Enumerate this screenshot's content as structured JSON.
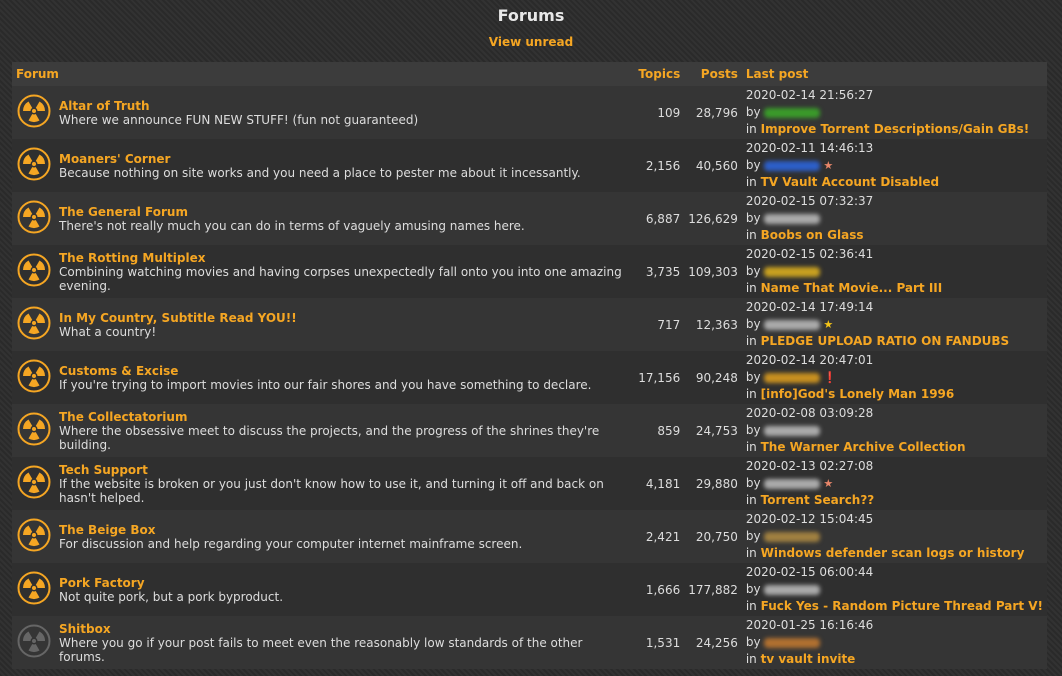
{
  "title": "Forums",
  "view_unread": "View unread",
  "headers": {
    "forum": "Forum",
    "topics": "Topics",
    "posts": "Posts",
    "last_post": "Last post"
  },
  "by": "by",
  "in": "in",
  "forums": [
    {
      "name": "Altar of Truth",
      "desc": "Where we announce FUN NEW STUFF! (fun not guaranteed)",
      "topics": "109",
      "posts": "28,796",
      "date": "2020-02-14 21:56:27",
      "user_color": "#3a9a2a",
      "badge": "",
      "thread": "Improve Torrent Descriptions/Gain GBs!",
      "icon_color": "#f5a623"
    },
    {
      "name": "Moaners' Corner",
      "desc": "Because nothing on site works and you need a place to pester me about it incessantly.",
      "topics": "2,156",
      "posts": "40,560",
      "date": "2020-02-11 14:46:13",
      "user_color": "#2d5fc8",
      "badge": "★",
      "badge_color": "#e8866a",
      "thread": "TV Vault Account Disabled",
      "icon_color": "#f5a623"
    },
    {
      "name": "The General Forum",
      "desc": "There's not really much you can do in terms of vaguely amusing names here.",
      "topics": "6,887",
      "posts": "126,629",
      "date": "2020-02-15 07:32:37",
      "user_color": "#aaaaaa",
      "badge": "",
      "thread": "Boobs on Glass",
      "icon_color": "#f5a623"
    },
    {
      "name": "The Rotting Multiplex",
      "desc": "Combining watching movies and having corpses unexpectedly fall onto you into one amazing evening.",
      "topics": "3,735",
      "posts": "109,303",
      "date": "2020-02-15 02:36:41",
      "user_color": "#c8a020",
      "badge": "",
      "thread": "Name That Movie... Part III",
      "icon_color": "#f5a623"
    },
    {
      "name": "In My Country, Subtitle Read YOU!!",
      "desc": "What a country!",
      "topics": "717",
      "posts": "12,363",
      "date": "2020-02-14 17:49:14",
      "user_color": "#aaaaaa",
      "badge": "★",
      "badge_color": "#f5c518",
      "thread": "PLEDGE UPLOAD RATIO ON FANDUBS",
      "icon_color": "#f5a623"
    },
    {
      "name": "Customs & Excise",
      "desc": "If you're trying to import movies into our fair shores and you have something to declare.",
      "topics": "17,156",
      "posts": "90,248",
      "date": "2020-02-14 20:47:01",
      "user_color": "#c89020",
      "badge": "❗",
      "badge_color": "#e02020",
      "thread": "[info]God's Lonely Man 1996",
      "icon_color": "#f5a623"
    },
    {
      "name": "The Collectatorium",
      "desc": "Where the obsessive meet to discuss the projects, and the progress of the shrines they're building.",
      "topics": "859",
      "posts": "24,753",
      "date": "2020-02-08 03:09:28",
      "user_color": "#aaaaaa",
      "badge": "",
      "thread": "The Warner Archive Collection",
      "icon_color": "#f5a623"
    },
    {
      "name": "Tech Support",
      "desc": "If the website is broken or you just don't know how to use it, and turning it off and back on hasn't helped.",
      "topics": "4,181",
      "posts": "29,880",
      "date": "2020-02-13 02:27:08",
      "user_color": "#aaaaaa",
      "badge": "★",
      "badge_color": "#e8866a",
      "thread": "Torrent Search??",
      "icon_color": "#f5a623"
    },
    {
      "name": "The Beige Box",
      "desc": "For discussion and help regarding your computer internet mainframe screen.",
      "topics": "2,421",
      "posts": "20,750",
      "date": "2020-02-12 15:04:45",
      "user_color": "#a08040",
      "badge": "",
      "thread": "Windows defender scan logs or history",
      "icon_color": "#f5a623"
    },
    {
      "name": "Pork Factory",
      "desc": "Not quite pork, but a pork byproduct.",
      "topics": "1,666",
      "posts": "177,882",
      "date": "2020-02-15 06:00:44",
      "user_color": "#aaaaaa",
      "badge": "",
      "thread": "Fuck Yes - Random Picture Thread Part V!",
      "icon_color": "#f5a623"
    },
    {
      "name": "Shitbox",
      "desc": "Where you go if your post fails to meet even the reasonably low standards of the other forums.",
      "topics": "1,531",
      "posts": "24,256",
      "date": "2020-01-25 16:16:46",
      "user_color": "#b07030",
      "badge": "",
      "thread": "tv vault invite",
      "icon_color": "#666666"
    }
  ]
}
